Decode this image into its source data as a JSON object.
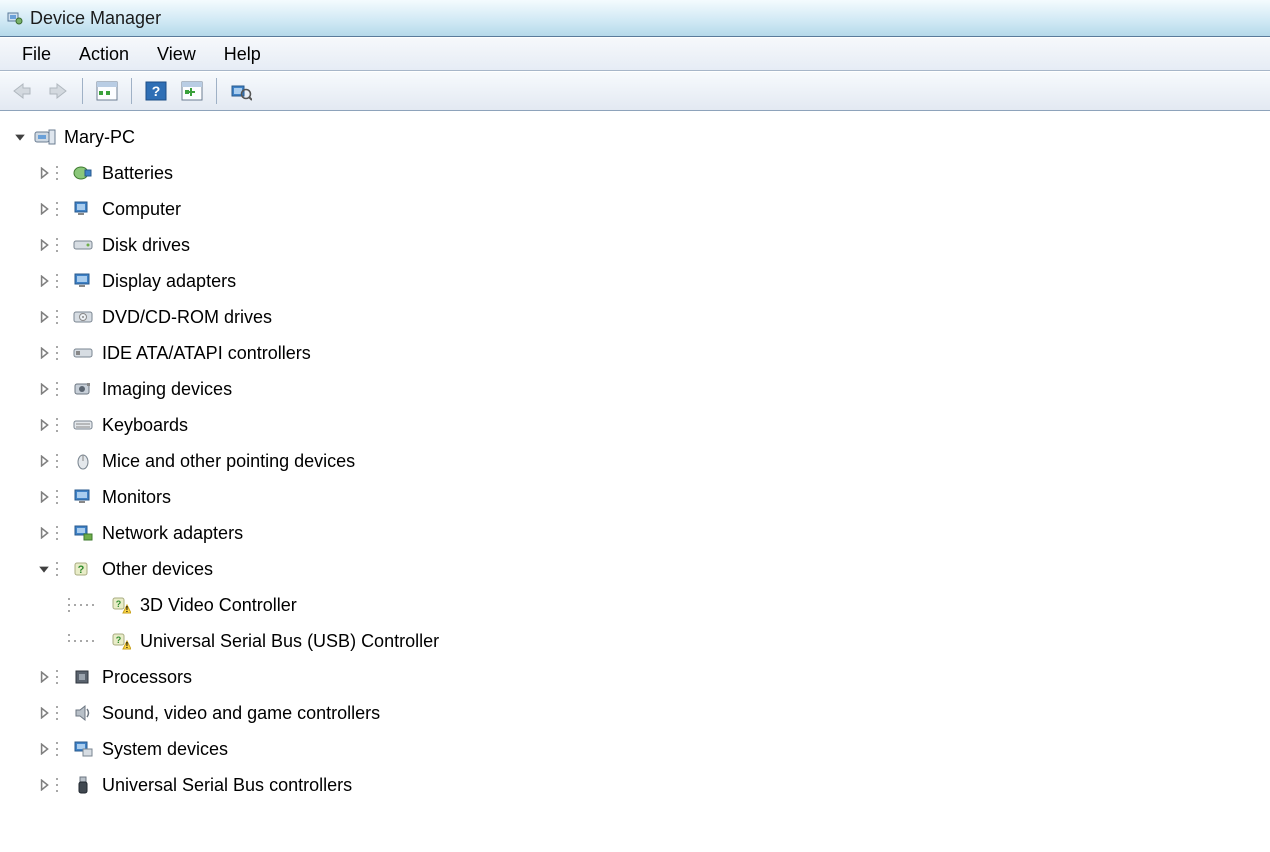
{
  "window": {
    "title": "Device Manager"
  },
  "menu": {
    "file": "File",
    "action": "Action",
    "view": "View",
    "help": "Help"
  },
  "tree": {
    "root": "Mary-PC",
    "categories": [
      {
        "label": "Batteries",
        "icon": "battery-icon",
        "expanded": false
      },
      {
        "label": "Computer",
        "icon": "computer-icon",
        "expanded": false
      },
      {
        "label": "Disk drives",
        "icon": "disk-icon",
        "expanded": false
      },
      {
        "label": "Display adapters",
        "icon": "display-icon",
        "expanded": false
      },
      {
        "label": "DVD/CD-ROM drives",
        "icon": "cdrom-icon",
        "expanded": false
      },
      {
        "label": "IDE ATA/ATAPI controllers",
        "icon": "ide-icon",
        "expanded": false
      },
      {
        "label": "Imaging devices",
        "icon": "imaging-icon",
        "expanded": false
      },
      {
        "label": "Keyboards",
        "icon": "keyboard-icon",
        "expanded": false
      },
      {
        "label": "Mice and other pointing devices",
        "icon": "mouse-icon",
        "expanded": false
      },
      {
        "label": "Monitors",
        "icon": "monitor-icon",
        "expanded": false
      },
      {
        "label": "Network adapters",
        "icon": "network-icon",
        "expanded": false
      },
      {
        "label": "Other devices",
        "icon": "unknown-icon",
        "expanded": true,
        "children": [
          {
            "label": "3D Video Controller",
            "icon": "warning-device-icon"
          },
          {
            "label": "Universal Serial Bus (USB) Controller",
            "icon": "warning-device-icon"
          }
        ]
      },
      {
        "label": "Processors",
        "icon": "cpu-icon",
        "expanded": false
      },
      {
        "label": "Sound, video and game controllers",
        "icon": "sound-icon",
        "expanded": false
      },
      {
        "label": "System devices",
        "icon": "system-icon",
        "expanded": false
      },
      {
        "label": "Universal Serial Bus controllers",
        "icon": "usb-icon",
        "expanded": false
      }
    ]
  },
  "arrow_target_index": 13
}
